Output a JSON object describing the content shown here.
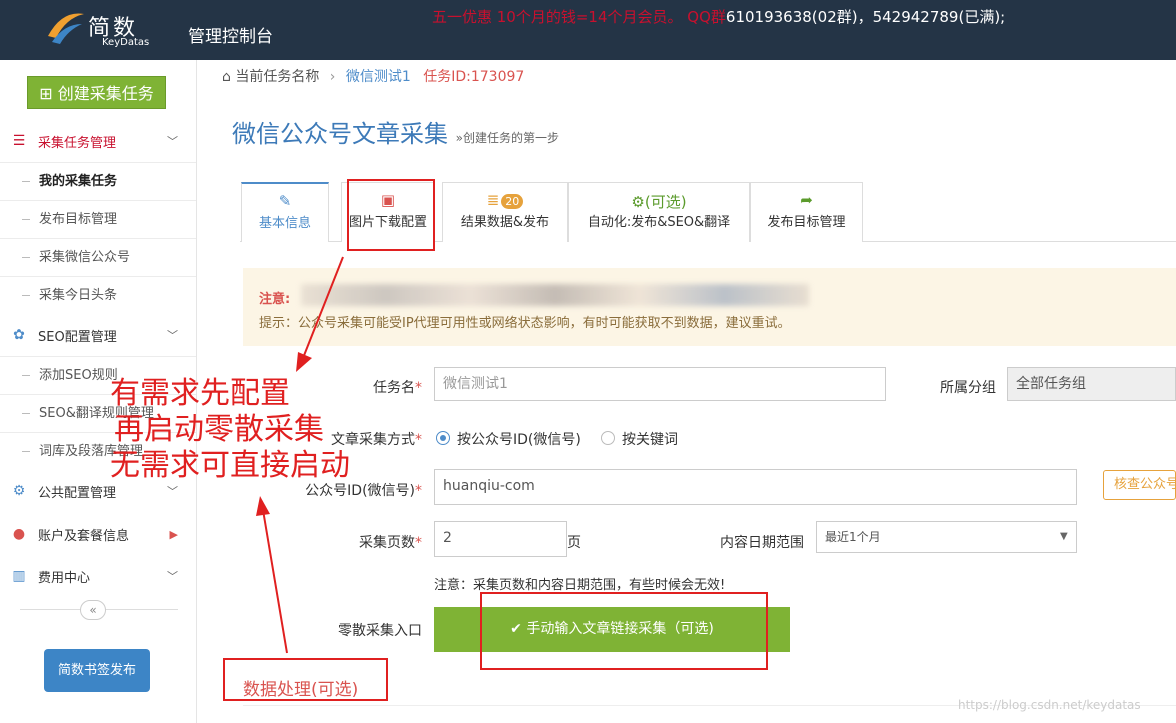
{
  "header": {
    "logo_text": "简数",
    "logo_sub": "KeyDatas",
    "console_title": "管理控制台",
    "promo_red": "五一优惠 10个月的钱=14个月会员。 QQ群",
    "promo_white": "610193638(02群)，542942789(已满);"
  },
  "sidebar": {
    "create_task": "创建采集任务",
    "group_task": "采集任务管理",
    "items_task": [
      "我的采集任务",
      "发布目标管理",
      "采集微信公众号",
      "采集今日头条"
    ],
    "group_seo": "SEO配置管理",
    "items_seo": [
      "添加SEO规则",
      "SEO&翻译规则管理",
      "词库及段落库管理"
    ],
    "group_public": "公共配置管理",
    "group_account": "账户及套餐信息",
    "group_fee": "费用中心",
    "collapse": "«",
    "publish_btn": "简数书签发布"
  },
  "breadcrumb": {
    "current": "当前任务名称",
    "sep": "›",
    "task_name": "微信测试1",
    "task_id": "任务ID:173097"
  },
  "page": {
    "title": "微信公众号文章采集",
    "subtitle": "»创建任务的第一步"
  },
  "tabs": [
    {
      "label": "基本信息"
    },
    {
      "label": "图片下载配置"
    },
    {
      "label": "结果数据&发布",
      "badge": "20"
    },
    {
      "label": "自动化:发布&SEO&翻译",
      "icon_label": "(可选)"
    },
    {
      "label": "发布目标管理"
    }
  ],
  "notice": {
    "title": "注意:",
    "tip": "提示：公众号采集可能受IP代理可用性或网络状态影响，有时可能获取不到数据，建议重试。"
  },
  "form": {
    "task_name_label": "任务名",
    "task_name_value": "微信测试1",
    "group_label": "所属分组",
    "group_value": "全部任务组",
    "method_label": "文章采集方式",
    "method_opt1": "按公众号ID(微信号)",
    "method_opt2": "按关键词",
    "wechat_id_label": "公众号ID(微信号)",
    "wechat_id_value": "huanqiu-com",
    "check_btn": "核查公众号",
    "pages_label": "采集页数",
    "pages_value": "2",
    "pages_unit": "页",
    "date_label": "内容日期范围",
    "date_value": "最近1个月",
    "pages_note": "注意：采集页数和内容日期范围，有些时候会无效!",
    "scatter_label": "零散采集入口",
    "manual_btn": "手动输入文章链接采集（可选)",
    "data_process": "数据处理(可选)",
    "required_mark": "*"
  },
  "annotation": {
    "line1": "有需求先配置",
    "line2": "再启动零散采集",
    "line3": "无需求可直接启动"
  },
  "watermark": "https://blog.csdn.net/keydatas"
}
